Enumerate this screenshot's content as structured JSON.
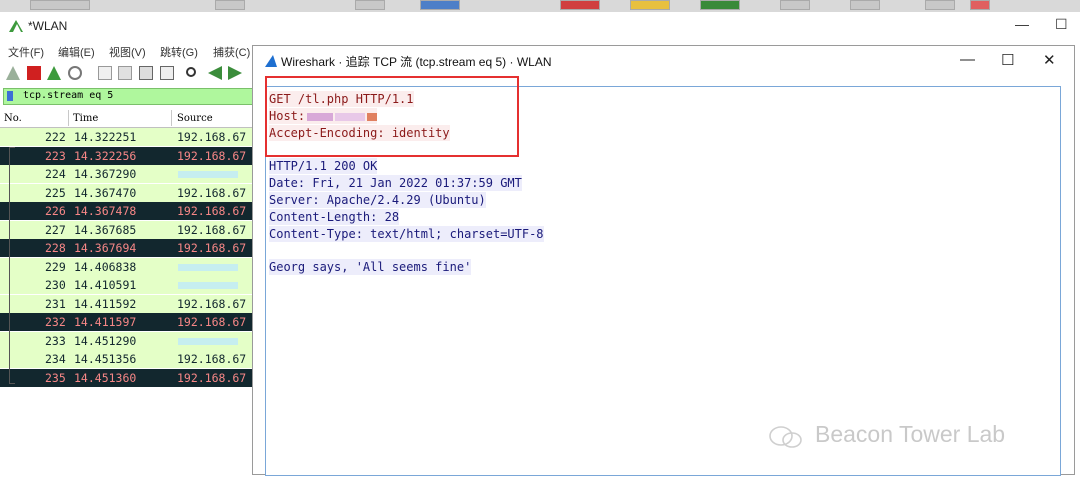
{
  "main_window": {
    "title": "*WLAN",
    "menu": [
      "文件(F)",
      "编辑(E)",
      "视图(V)",
      "跳转(G)",
      "捕获(C)"
    ],
    "filter": "tcp.stream eq 5",
    "columns": [
      "No.",
      "Time",
      "Source"
    ],
    "rows": [
      {
        "no": "222",
        "time": "14.322251",
        "source": "192.168.67",
        "style": "light"
      },
      {
        "no": "223",
        "time": "14.322256",
        "source": "192.168.67",
        "style": "dark"
      },
      {
        "no": "224",
        "time": "14.367290",
        "source": "",
        "style": "light"
      },
      {
        "no": "225",
        "time": "14.367470",
        "source": "192.168.67",
        "style": "light"
      },
      {
        "no": "226",
        "time": "14.367478",
        "source": "192.168.67",
        "style": "dark"
      },
      {
        "no": "227",
        "time": "14.367685",
        "source": "192.168.67",
        "style": "light"
      },
      {
        "no": "228",
        "time": "14.367694",
        "source": "192.168.67",
        "style": "dark"
      },
      {
        "no": "229",
        "time": "14.406838",
        "source": "",
        "style": "light"
      },
      {
        "no": "230",
        "time": "14.410591",
        "source": "",
        "style": "light"
      },
      {
        "no": "231",
        "time": "14.411592",
        "source": "192.168.67",
        "style": "light"
      },
      {
        "no": "232",
        "time": "14.411597",
        "source": "192.168.67",
        "style": "dark"
      },
      {
        "no": "233",
        "time": "14.451290",
        "source": "",
        "style": "light"
      },
      {
        "no": "234",
        "time": "14.451356",
        "source": "192.168.67",
        "style": "light"
      },
      {
        "no": "235",
        "time": "14.451360",
        "source": "192.168.67",
        "style": "dark"
      }
    ]
  },
  "dialog": {
    "title": "Wireshark · 追踪 TCP 流 (tcp.stream eq 5) · WLAN",
    "controls": {
      "minimize": "—",
      "maximize": "☐",
      "close": "✕"
    },
    "request_lines": [
      "GET /tl.php HTTP/1.1",
      "Host:",
      "Accept-Encoding: identity"
    ],
    "response_lines": [
      "HTTP/1.1 200 OK",
      "Date: Fri, 21 Jan 2022 01:37:59 GMT",
      "Server: Apache/2.4.29 (Ubuntu)",
      "Content-Length: 28",
      "Content-Type: text/html; charset=UTF-8",
      "",
      "Georg says, 'All seems fine'"
    ]
  },
  "watermark": "Beacon Tower Lab",
  "colors": {
    "filter_bg": "#aff79d",
    "row_light": "#e4ffc7",
    "row_dark": "#12272e",
    "row_dark_text": "#f78787",
    "request_text": "#8b1a1a",
    "response_text": "#1a1a7a",
    "highlight_box": "#e53030"
  }
}
